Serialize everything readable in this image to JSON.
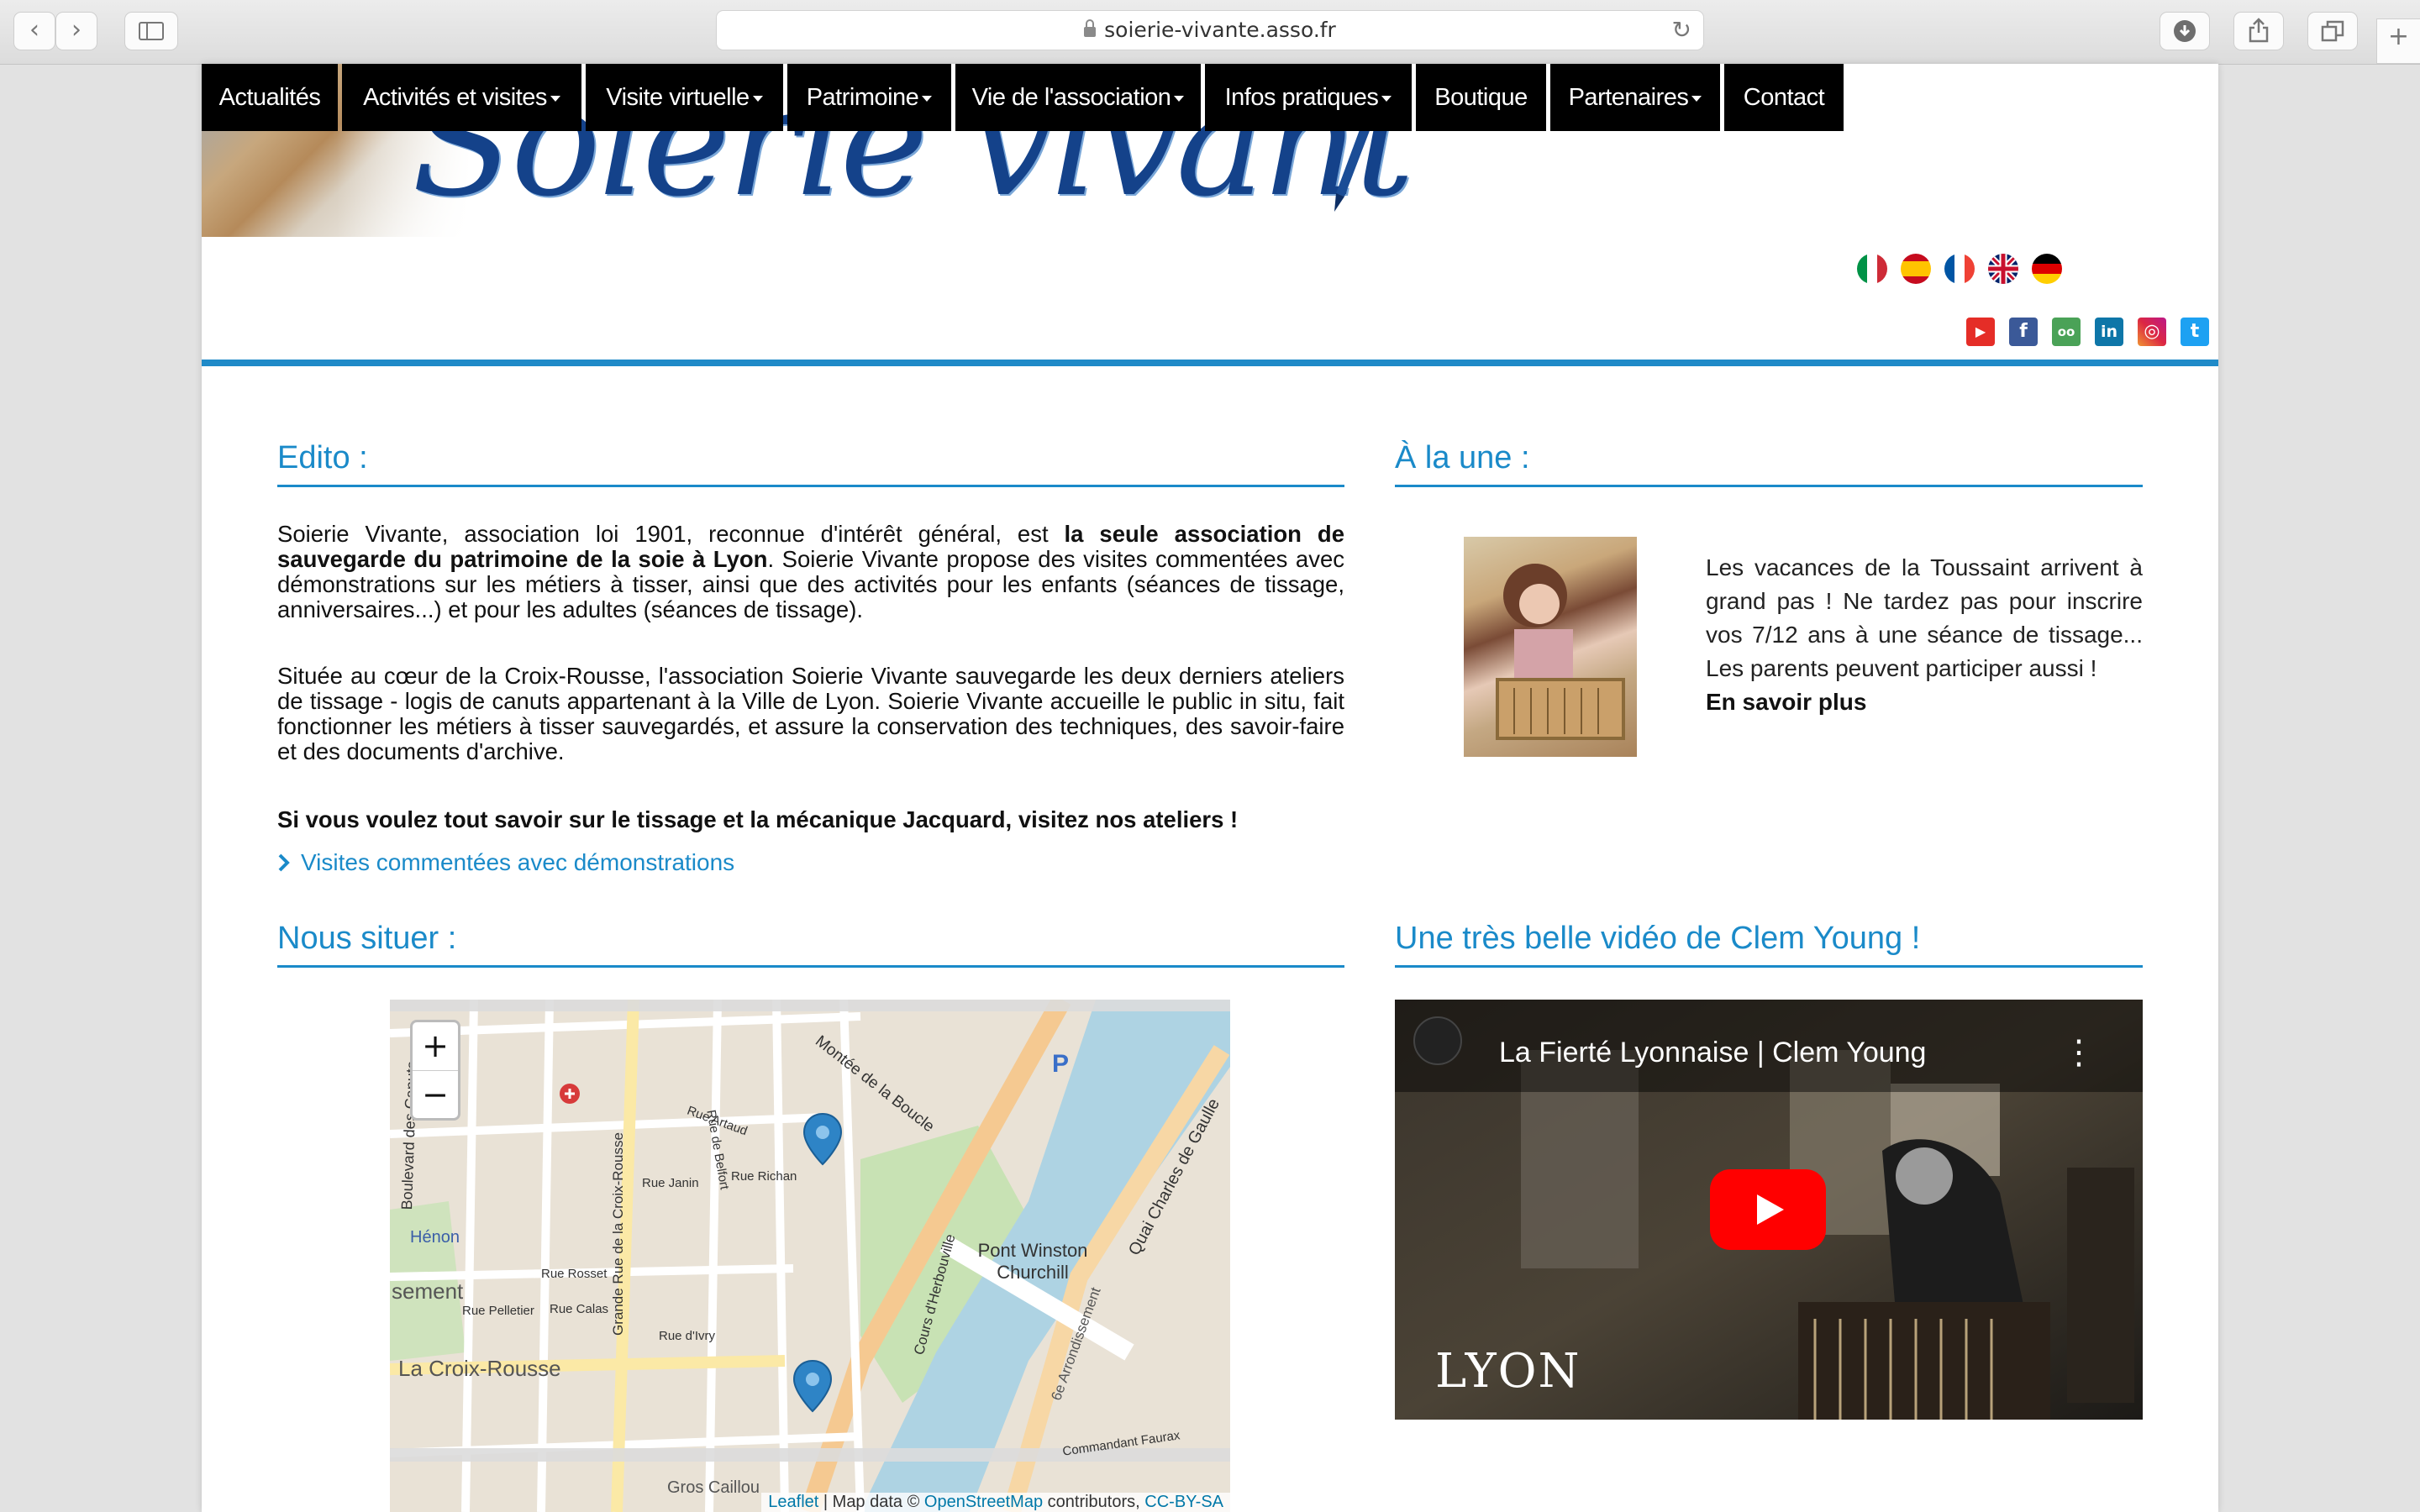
{
  "browser": {
    "url": "soierie-vivante.asso.fr",
    "back_glyph": "‹",
    "forward_glyph": "›",
    "new_tab_glyph": "+"
  },
  "header": {
    "logo_text": "Soierie vivante !"
  },
  "nav": [
    {
      "label": "Actualités",
      "dropdown": false
    },
    {
      "label": "Activités et visites",
      "dropdown": true
    },
    {
      "label": "Visite virtuelle",
      "dropdown": true
    },
    {
      "label": "Patrimoine",
      "dropdown": true
    },
    {
      "label": "Vie de l'association",
      "dropdown": true
    },
    {
      "label": "Infos pratiques",
      "dropdown": true
    },
    {
      "label": "Boutique",
      "dropdown": false
    },
    {
      "label": "Partenaires",
      "dropdown": true
    },
    {
      "label": "Contact",
      "dropdown": false
    }
  ],
  "flags": [
    "italian-flag-icon",
    "spanish-flag-icon",
    "french-flag-icon",
    "uk-flag-icon",
    "german-flag-icon"
  ],
  "social": [
    {
      "name": "youtube-icon",
      "glyph": "▶",
      "color": "#e52d27"
    },
    {
      "name": "facebook-icon",
      "glyph": "f",
      "color": "#3b5998"
    },
    {
      "name": "tripadvisor-icon",
      "glyph": "oo",
      "color": "#4aa257"
    },
    {
      "name": "linkedin-icon",
      "glyph": "in",
      "color": "#0e76a8"
    },
    {
      "name": "instagram-icon",
      "glyph": "◎",
      "color": "#c13584"
    },
    {
      "name": "twitter-icon",
      "glyph": "t",
      "color": "#1da1f2"
    }
  ],
  "edito": {
    "title": "Edito :",
    "p1_a": "Soierie Vivante, association loi 1901, reconnue d'intérêt général, est ",
    "p1_bold": "la seule association de sauvegarde du patrimoine de la soie à Lyon",
    "p1_b": ". Soierie Vivante propose des visites commentées avec démonstrations sur les métiers à tisser, ainsi que des activités pour les enfants (séances de tissage, anniversaires...) et pour les adultes (séances de tissage).",
    "p2": "Située au cœur de la Croix-Rousse, l'association Soierie Vivante sauvegarde les deux derniers ateliers de tissage - logis de canuts appartenant à la Ville de Lyon. Soierie Vivante accueille le public in situ, fait fonctionner les métiers à tisser sauvegardés, et assure la conservation des techniques, des savoir-faire et des documents d'archive.",
    "p3": "Si vous voulez tout savoir sur le tissage et la mécanique Jacquard, visitez nos ateliers !",
    "link": "Visites commentées avec démonstrations"
  },
  "a_la_une": {
    "title": "À la une :",
    "text": "Les vacances de la Toussaint arrivent à grand pas ! Ne tardez pas pour inscrire vos 7/12 ans à une séance de tissage... Les parents peuvent participer aussi !",
    "more": "En savoir plus"
  },
  "map_section": {
    "title": "Nous situer :",
    "zoom_in": "+",
    "zoom_out": "−",
    "labels": {
      "montee": "Montée de la Boucle",
      "pont": "Pont Winston Churchill",
      "quai": "Quai Charles de Gaulle",
      "croix_rousse": "La Croix-Rousse",
      "henon": "Hénon",
      "boulevard": "Boulevard des Canuts",
      "grande_rue": "Grande Rue de la Croix-Rousse",
      "rue_artaud": "Rue Artaud",
      "rue_janin": "Rue Janin",
      "rue_richan": "Rue Richan",
      "rue_rosset": "Rue Rosset",
      "rue_calas": "Rue Calas",
      "rue_pelletier": "Rue Pelletier",
      "rue_divry": "Rue d'Ivry",
      "rue_belfort": "Rue de Belfort",
      "herbouville": "Cours d'Herbouville",
      "arrondissement": "6e Arrondissement",
      "commandant": "Commandant Faurax",
      "gros_caillou": "Gros Caillou",
      "sement": "sement",
      "parking": "P"
    },
    "attribution_leaflet": "Leaflet",
    "attribution_sep": " | Map data © ",
    "attribution_osm": "OpenStreetMap",
    "attribution_contrib": " contributors, ",
    "attribution_license": "CC-BY-SA"
  },
  "video_section": {
    "title": "Une très belle vidéo de Clem Young !",
    "video_title": "La Fierté Lyonnaise | Clem Young",
    "overlay_text": "LYON",
    "menu_glyph": "⋮"
  }
}
